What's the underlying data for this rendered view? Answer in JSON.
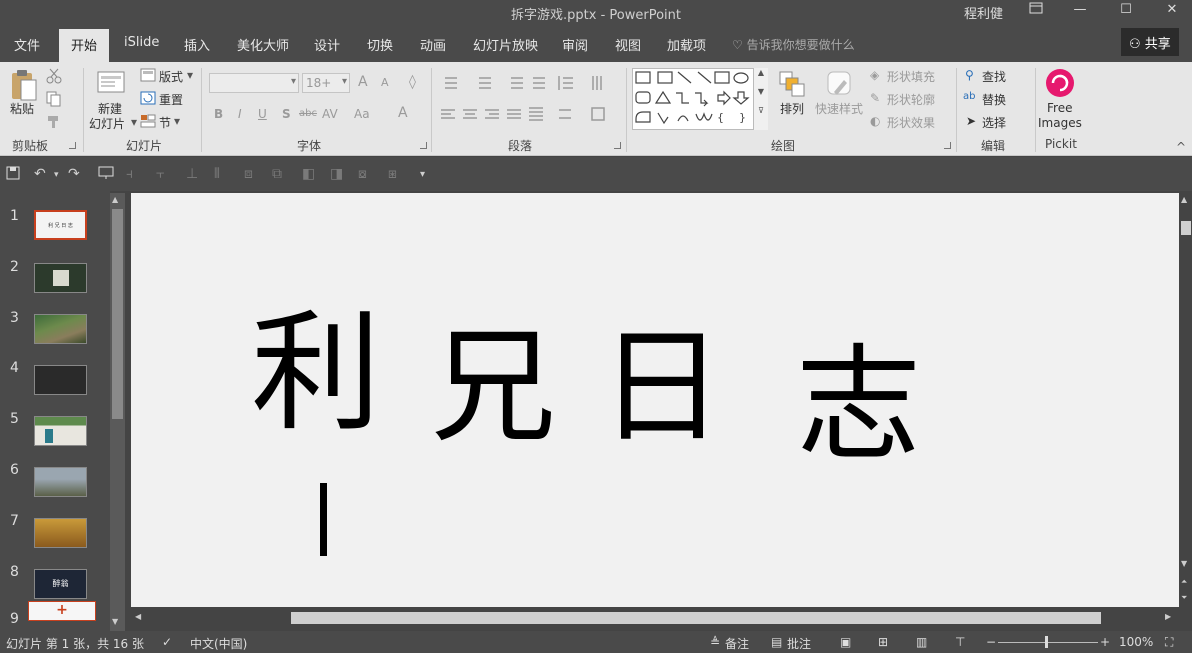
{
  "titlebar": {
    "title": "拆字游戏.pptx  -  PowerPoint",
    "user": "程利健",
    "ribbon_display_icon": "ribbon-display-icon",
    "minimize": "—",
    "maximize": "☐",
    "close": "✕"
  },
  "tabs": [
    "文件",
    "开始",
    "iSlide",
    "插入",
    "美化大师",
    "设计",
    "切换",
    "动画",
    "幻灯片放映",
    "审阅",
    "视图",
    "加载项"
  ],
  "active_tab": "开始",
  "tell_me": "告诉我你想要做什么",
  "share": "共享",
  "ribbon": {
    "clipboard": {
      "paste": "粘贴",
      "label": "剪贴板"
    },
    "slides": {
      "new_slide_1": "新建",
      "new_slide_2": "幻灯片",
      "layout": "版式",
      "reset": "重置",
      "section": "节",
      "label": "幻灯片"
    },
    "font": {
      "font_name": "",
      "font_size": "18+",
      "bold": "B",
      "italic": "I",
      "underline": "U",
      "shadow": "S",
      "strike": "abc",
      "spacing": "AV",
      "case": "Aa",
      "color": "A",
      "grow": "A",
      "shrink": "A",
      "label": "字体"
    },
    "paragraph": {
      "label": "段落"
    },
    "drawing": {
      "arrange": "排列",
      "quick_styles": "快速样式",
      "shape_fill": "形状填充",
      "shape_outline": "形状轮廓",
      "shape_effects": "形状效果",
      "label": "绘图"
    },
    "editing": {
      "find": "查找",
      "replace": "替换",
      "select": "选择",
      "label": "编辑"
    },
    "pickit": {
      "line1": "Free",
      "line2": "Images",
      "label": "Pickit"
    }
  },
  "slides": [
    {
      "num": "1",
      "selected": true,
      "thumb_text": "利 兄 日 志"
    },
    {
      "num": "2"
    },
    {
      "num": "3"
    },
    {
      "num": "4"
    },
    {
      "num": "5"
    },
    {
      "num": "6"
    },
    {
      "num": "7"
    },
    {
      "num": "8",
      "thumb_text": "醉翁"
    },
    {
      "num": "9"
    }
  ],
  "add_slide": "+",
  "slide_content": {
    "char1": "利",
    "char1_piece": "丨",
    "char2": "兄",
    "char3": "日",
    "char4": "志"
  },
  "status": {
    "slide_info": "幻灯片 第 1 张，共 16 张",
    "language": "中文(中国)",
    "notes": "备注",
    "comments": "批注",
    "zoom": "100%"
  },
  "colors": {
    "chrome_dark": "#4a4a4a",
    "ribbon_bg": "#e6e6e6",
    "slide_bg": "#f1f1f1",
    "selected_thumb_border": "#c8401e",
    "pickit_accent": "#e6196e"
  }
}
